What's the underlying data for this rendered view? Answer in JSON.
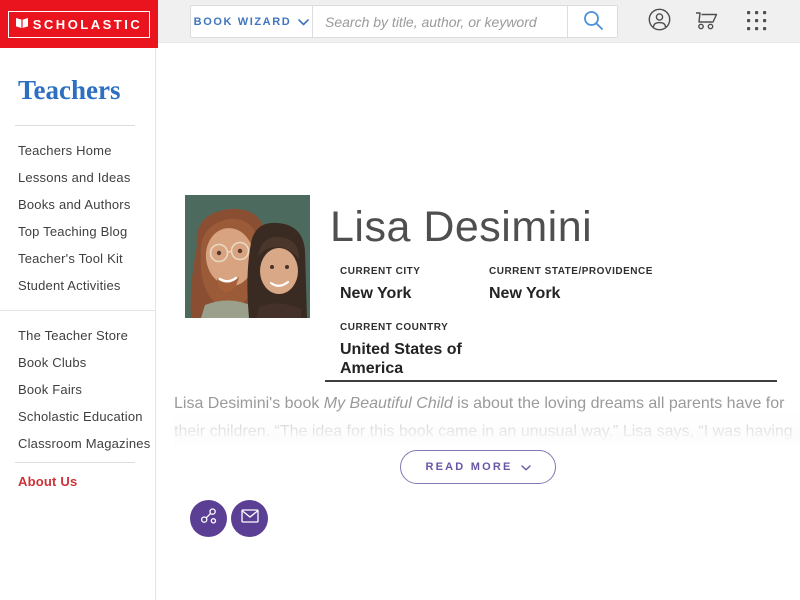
{
  "header": {
    "logo_text": "SCHOLASTIC",
    "book_wizard_label": "BOOK WIZARD",
    "search_placeholder": "Search by title, author, or keyword",
    "icons": {
      "logo_glyph": "open-book-icon",
      "dropdown": "chevron-down-icon",
      "search": "magnifier-icon",
      "account": "user-circle-icon",
      "cart": "shopping-cart-icon",
      "apps": "grid-dots-icon"
    }
  },
  "sidebar": {
    "title": "Teachers",
    "nav_primary": [
      "Teachers Home",
      "Lessons and Ideas",
      "Books and Authors",
      "Top Teaching Blog",
      "Teacher's Tool Kit",
      "Student Activities"
    ],
    "nav_secondary": [
      "The Teacher Store",
      "Book Clubs",
      "Book Fairs",
      "Scholastic Education",
      "Classroom Magazines"
    ],
    "about_label": "About Us"
  },
  "profile": {
    "name": "Lisa Desimini",
    "fields": [
      {
        "label": "CURRENT CITY",
        "value": "New York"
      },
      {
        "label": "CURRENT STATE/PROVIDENCE",
        "value": "New York"
      },
      {
        "label": "CURRENT COUNTRY",
        "value": "United States of America"
      }
    ],
    "bio": {
      "line1_prefix": "Lisa Desimini's book ",
      "book_title": "My Beautiful Child",
      "line1_suffix": " is about the loving dreams all parents have for",
      "line2": "their children. “The idea for this book came in an unusual way.” Lisa says, “I was having"
    },
    "read_more_label": "READ MORE",
    "social_icons": [
      "share-nodes-icon",
      "email-envelope-icon"
    ]
  },
  "colors": {
    "scholastic_red": "#e9141d",
    "header_gray": "#f0f0f1",
    "link_blue": "#4176bd",
    "heading_blue": "#2d6fc1",
    "about_red": "#cf3339",
    "accent_purple": "#5b3f94",
    "divider_dark": "#3f3f3f"
  }
}
